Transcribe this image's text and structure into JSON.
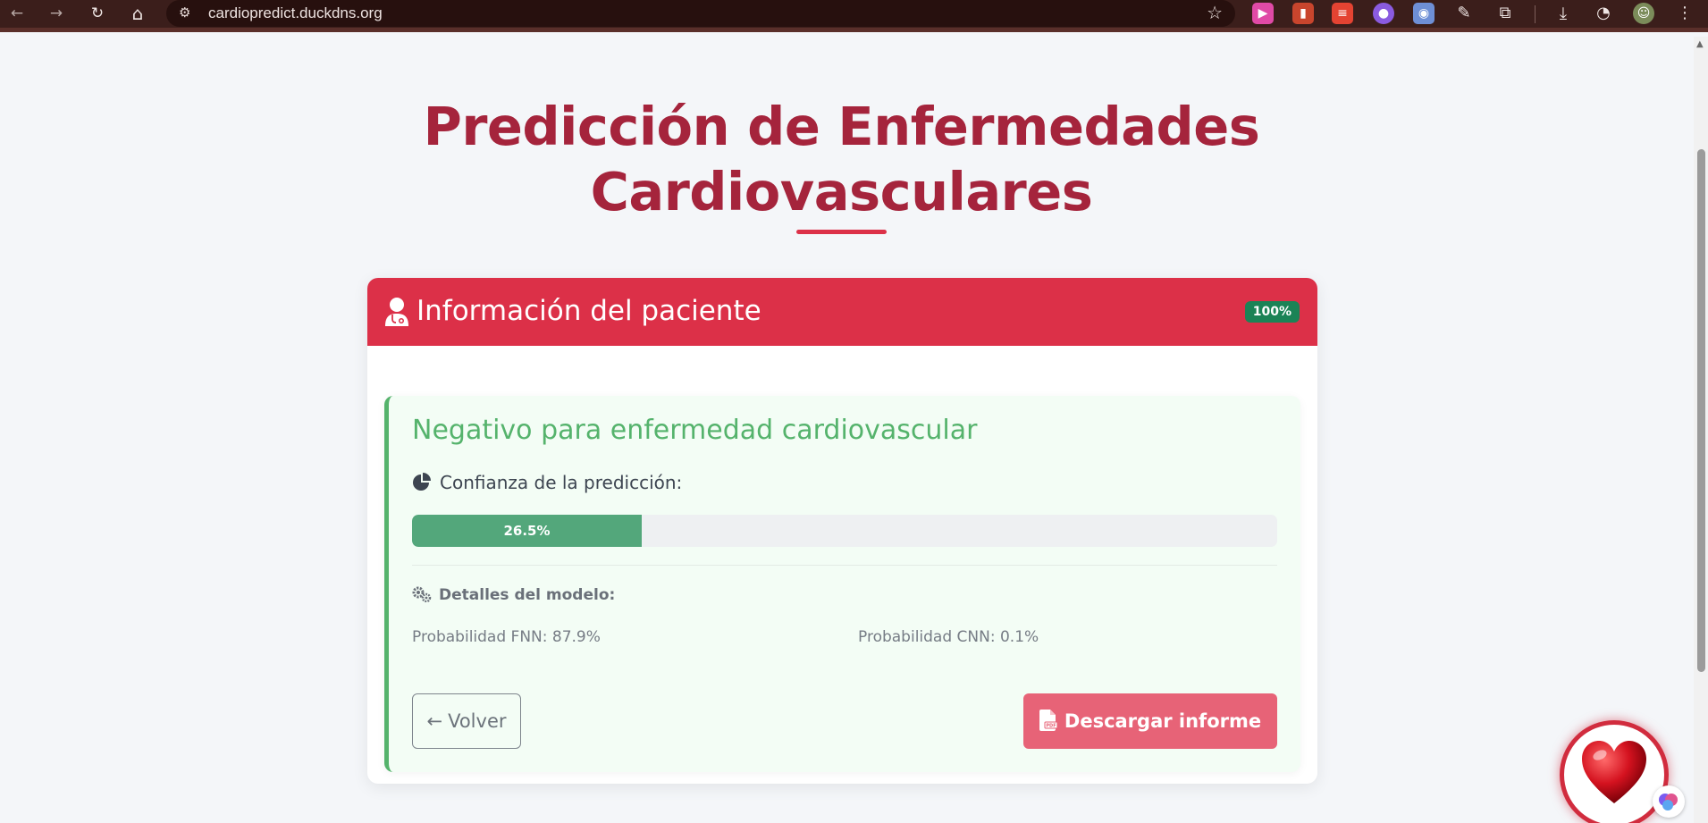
{
  "browser": {
    "url": "cardiopredict.duckdns.org",
    "nav": {
      "back_icon": "←",
      "forward_icon": "→",
      "reload_icon": "↻",
      "home_icon": "⌂"
    },
    "extensions": [
      "video-extension",
      "book-extension",
      "todoist-extension",
      "brain-extension",
      "incognito-extension",
      "eyedropper-extension",
      "puzzle-extension"
    ],
    "toolbar_icons": [
      "download-icon",
      "performance-icon",
      "profile-avatar",
      "menu-icon"
    ]
  },
  "page": {
    "title_line1": "Predicción de Enfermedades",
    "title_line2": "Cardiovasculares"
  },
  "card": {
    "header_title": "Información del paciente",
    "progress": "100%",
    "progress_value": 1.0,
    "result": {
      "title": "Negativo para enfermedad cardiovascular",
      "confidence_label": "Confianza de la predicción:",
      "confidence_value": "26.5%",
      "confidence_fraction": 0.265,
      "model_details_title": "Detalles del modelo:",
      "prob_fnn": "Probabilidad FNN: 87.9%",
      "prob_cnn": "Probabilidad CNN: 0.1%"
    },
    "buttons": {
      "back": "Volver",
      "download": "Descargar informe"
    }
  },
  "colors": {
    "brand_red": "#dc3048",
    "title_red": "#a5243c",
    "success_green": "#55b36c",
    "confidence_green": "#53a77b",
    "download_pink": "#e76377",
    "badge_green": "#1b8356"
  }
}
